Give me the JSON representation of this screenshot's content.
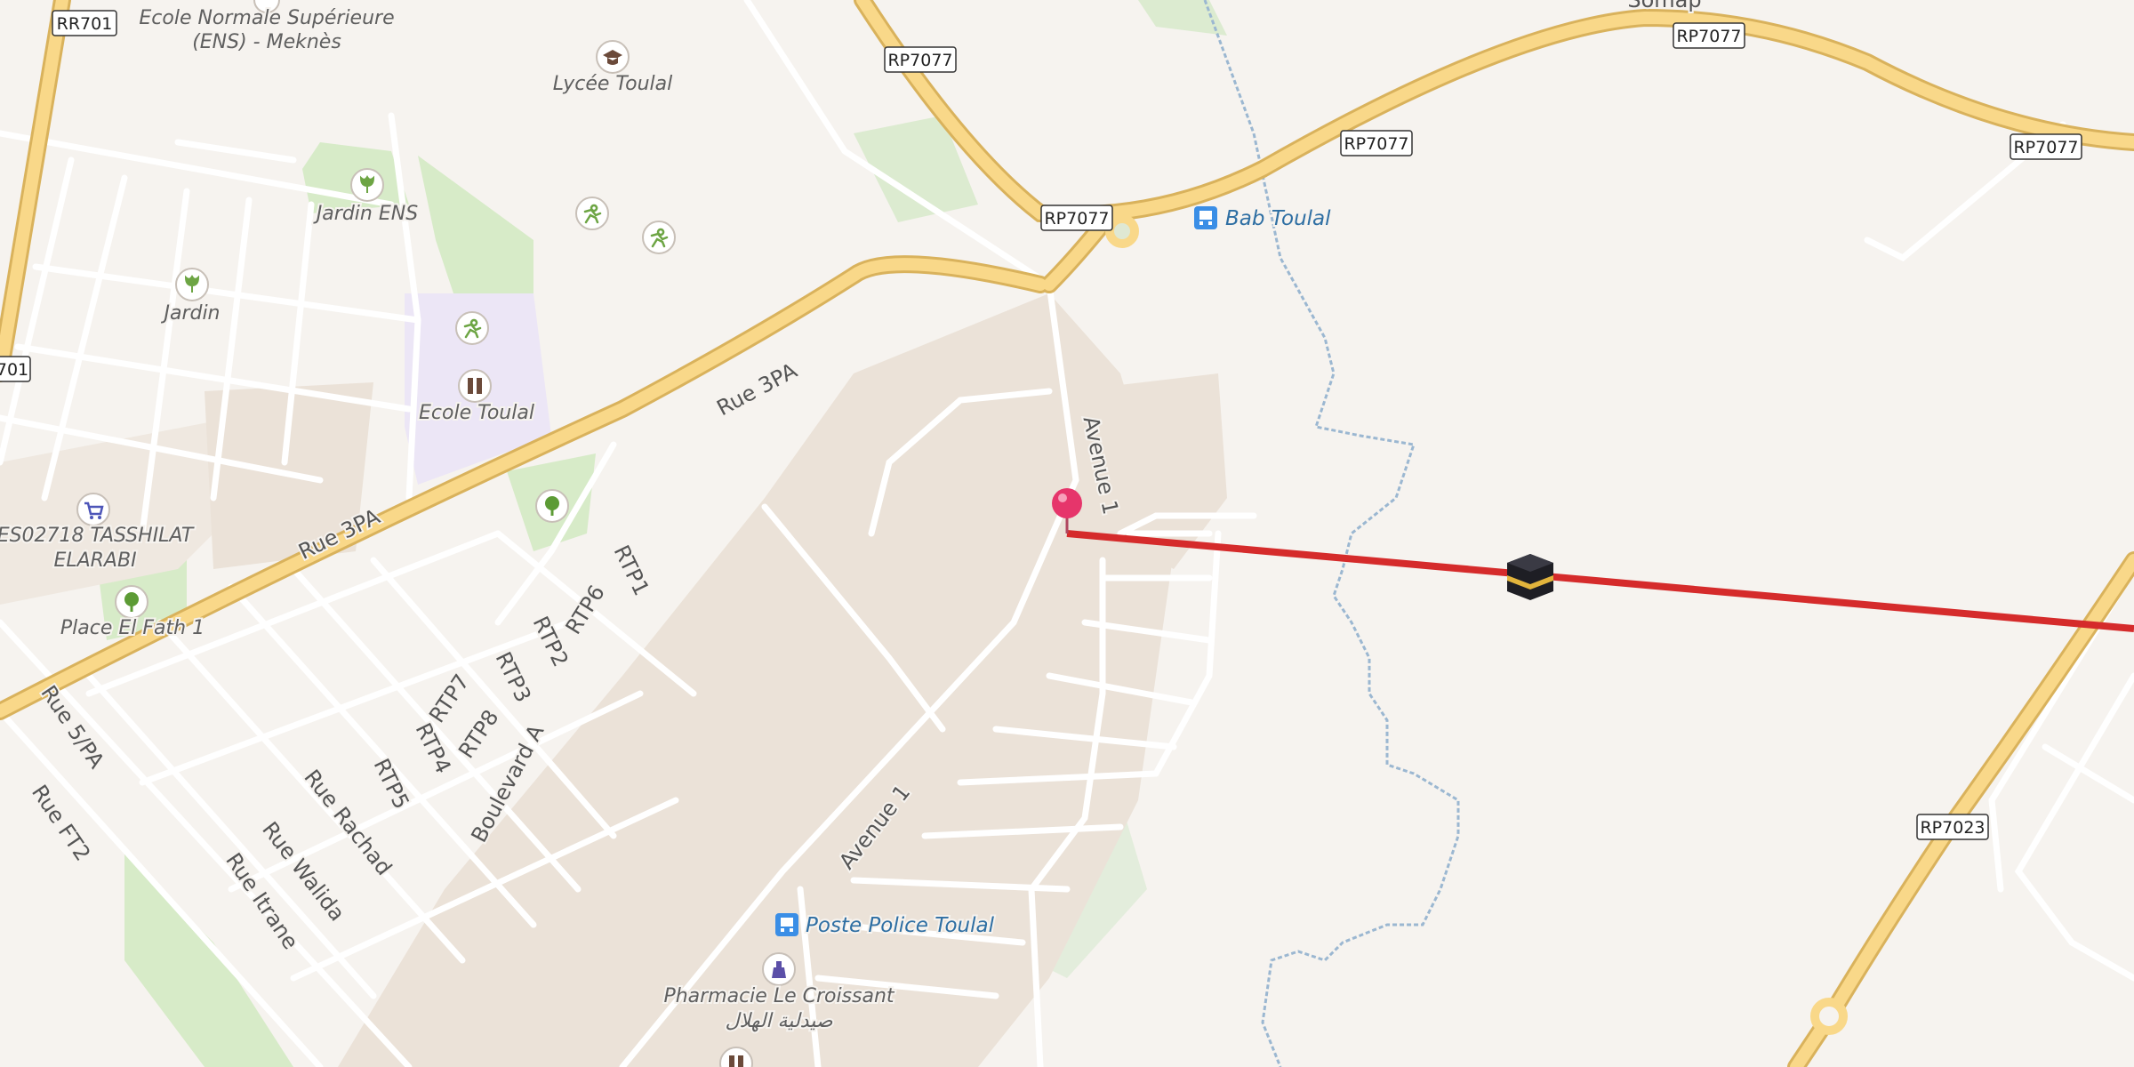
{
  "map": {
    "colors": {
      "background": "#f6f3ef",
      "highway_fill": "#f9d889",
      "highway_casing": "#d9b25c",
      "minor_road": "#ffffff",
      "road_casing": "#d9d3cb",
      "built_area": "#ebe2d8",
      "park": "#d7ebc8",
      "school_area": "#ece6f6",
      "stream": "#9bb7d1",
      "route_line": "#d52b2b",
      "pin": "#e6356b"
    },
    "route_shields": [
      {
        "label": "RR701"
      },
      {
        "label": "RP7077"
      },
      {
        "label": "RP7077"
      },
      {
        "label": "RP7077"
      },
      {
        "label": "RP7077"
      },
      {
        "label": "RP7077"
      },
      {
        "label": "701"
      },
      {
        "label": "RP7023"
      }
    ],
    "places": [
      {
        "name": "Ecole Normale Supérieure",
        "icon": "school-icon"
      },
      {
        "name": "(ENS) - Meknès",
        "icon": ""
      },
      {
        "name": "Lycée Toulal",
        "icon": "graduation-cap-icon"
      },
      {
        "name": "Jardin ENS",
        "icon": "garden-icon"
      },
      {
        "name": "Jardin",
        "icon": "garden-icon"
      },
      {
        "name": "Ecole Toulal",
        "icon": "school-icon"
      },
      {
        "name": "ES02718 TASSHILAT",
        "icon": "shopping-cart-icon"
      },
      {
        "name": "ELARABI",
        "icon": ""
      },
      {
        "name": "Place El Fath 1",
        "icon": "park-tree-icon"
      },
      {
        "name": "Pharmacie Le Croissant",
        "icon": "pharmacy-icon"
      },
      {
        "name": "صيدلية الهلال",
        "icon": ""
      }
    ],
    "transit": [
      {
        "name": "Bab Toulal",
        "icon": "bus-stop-icon"
      },
      {
        "name": "Poste Police Toulal",
        "icon": "bus-stop-icon"
      }
    ],
    "streets": [
      "Rue 3PA",
      "Rue 3PA",
      "Avenue 1",
      "Avenue 1",
      "RTP1",
      "RTP6",
      "RTP2",
      "RTP3",
      "RTP7",
      "RTP8",
      "RTP4",
      "RTP5",
      "Boulevard A",
      "Rue 5/PA",
      "Rue FT2",
      "Rue Rachad",
      "Rue Walida",
      "Rue Itrane",
      "Somap"
    ],
    "markers": {
      "pin": "location-pin-icon",
      "destination": "kaaba-icon"
    }
  }
}
